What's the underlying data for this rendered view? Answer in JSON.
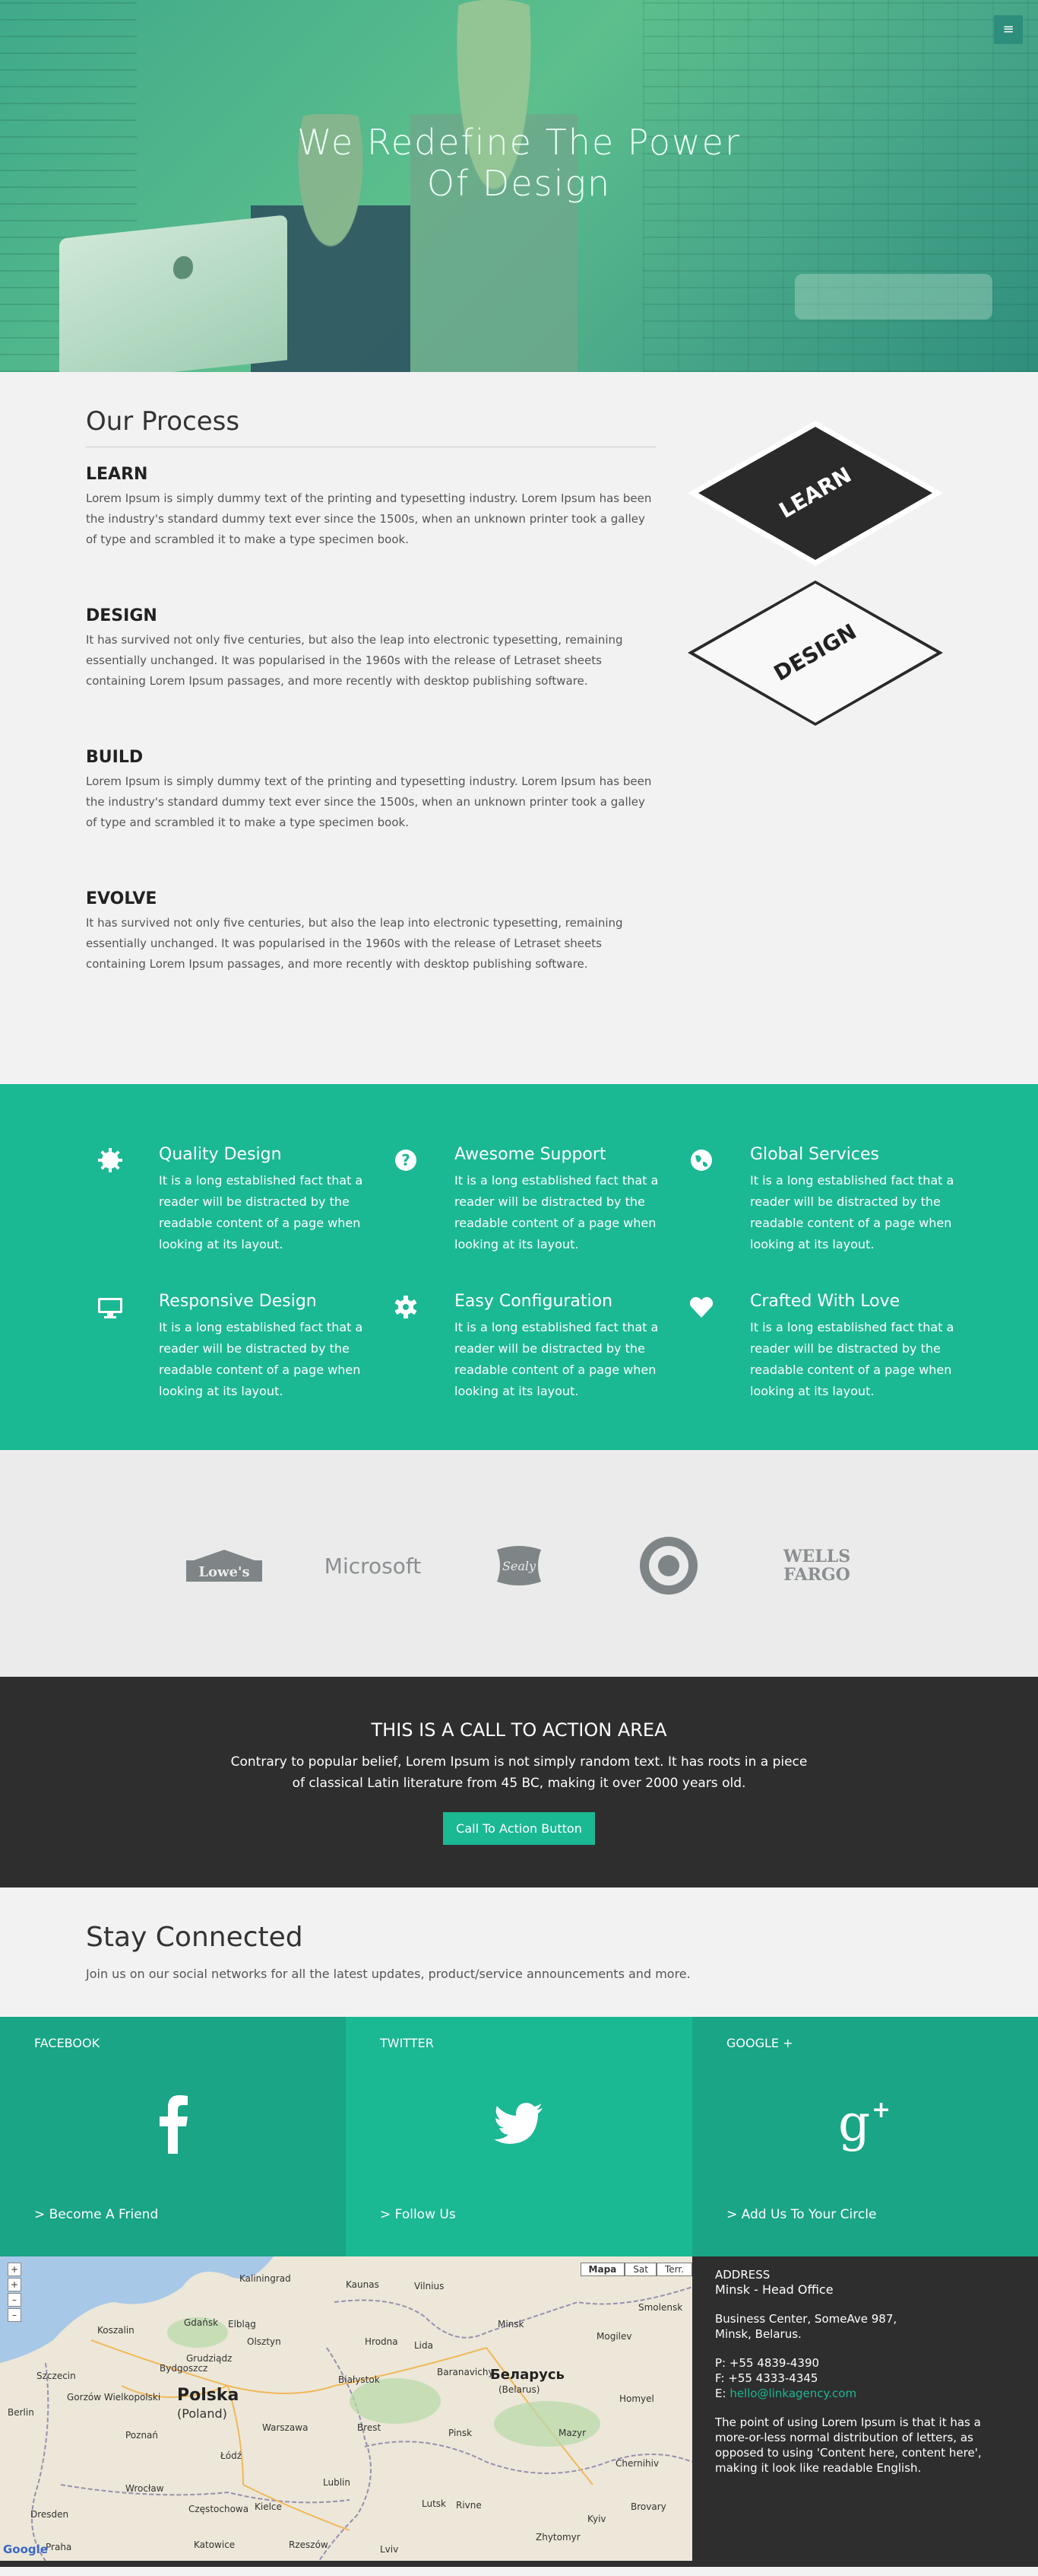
{
  "hero": {
    "title_line1": "We Redefine The Power",
    "title_line2": "Of Design",
    "menu_icon": "hamburger-icon"
  },
  "process": {
    "title": "Our Process",
    "steps": [
      {
        "title": "LEARN",
        "text": "Lorem Ipsum is simply dummy text of the printing and typesetting industry. Lorem Ipsum has been the industry's standard dummy text ever since the 1500s, when an unknown printer took a galley of type and scrambled it to make a type specimen book."
      },
      {
        "title": "DESIGN",
        "text": "It has survived not only five centuries, but also the leap into electronic typesetting, remaining essentially unchanged. It was popularised in the 1960s with the release of Letraset sheets containing Lorem Ipsum passages, and more recently with desktop publishing software."
      },
      {
        "title": "BUILD",
        "text": "Lorem Ipsum is simply dummy text of the printing and typesetting industry. Lorem Ipsum has been the industry's standard dummy text ever since the 1500s, when an unknown printer took a galley of type and scrambled it to make a type specimen book."
      },
      {
        "title": "EVOLVE",
        "text": "It has survived not only five centuries, but also the leap into electronic typesetting, remaining essentially unchanged. It was popularised in the 1960s with the release of Letraset sheets containing Lorem Ipsum passages, and more recently with desktop publishing software."
      }
    ],
    "badges": [
      "LEARN",
      "DESIGN"
    ]
  },
  "features": [
    {
      "icon": "gear-badge-icon",
      "title": "Quality Design",
      "text": "It is a long established fact that a reader will be distracted by the readable content of a page when looking at its layout."
    },
    {
      "icon": "question-circle-icon",
      "title": "Awesome Support",
      "text": "It is a long established fact that a reader will be distracted by the readable content of a page when looking at its layout."
    },
    {
      "icon": "globe-icon",
      "title": "Global Services",
      "text": "It is a long established fact that a reader will be distracted by the readable content of a page when looking at its layout."
    },
    {
      "icon": "desktop-icon",
      "title": "Responsive Design",
      "text": "It is a long established fact that a reader will be distracted by the readable content of a page when looking at its layout."
    },
    {
      "icon": "gear-icon",
      "title": "Easy Configuration",
      "text": "It is a long established fact that a reader will be distracted by the readable content of a page when looking at its layout."
    },
    {
      "icon": "heart-icon",
      "title": "Crafted With Love",
      "text": "It is a long established fact that a reader will be distracted by the readable content of a page when looking at its layout."
    }
  ],
  "logos": [
    "Lowe's",
    "Microsoft",
    "Sealy",
    "Target",
    "WELLS FARGO"
  ],
  "cta": {
    "title": "THIS IS A CALL TO ACTION AREA",
    "text": "Contrary to popular belief, Lorem Ipsum is not simply random text. It has roots in a piece of classical Latin literature from 45 BC, making it over 2000 years old.",
    "button": "Call To Action Button"
  },
  "stay": {
    "title": "Stay Connected",
    "text": "Join us on our social networks for all the latest updates, product/service announcements and more."
  },
  "social": [
    {
      "name": "FACEBOOK",
      "icon": "facebook-icon",
      "link": "> Become A Friend",
      "color": "#19a586"
    },
    {
      "name": "TWITTER",
      "icon": "twitter-icon",
      "link": "> Follow Us",
      "color": "#1bb894"
    },
    {
      "name": "GOOGLE +",
      "icon": "google-plus-icon",
      "link": "> Add Us To Your Circle",
      "color": "#19a586"
    }
  ],
  "map": {
    "types": [
      "Mapa",
      "Sat",
      "Terr."
    ],
    "labels": [
      "Kaliningrad",
      "Kaunas",
      "Vilnius",
      "Gdańsk",
      "Elbląg",
      "Olsztyn",
      "Koszalin",
      "Szczecin",
      "Gorzów Wielkopolski",
      "Bydgoszcz",
      "Grudziądz",
      "Poznań",
      "Berlin",
      "Warszawa",
      "Łódź",
      "Białystok",
      "Hrodna",
      "Minsk",
      "Lida",
      "Baranavichy",
      "Brest",
      "Pinsk",
      "Lublin",
      "Wrocław",
      "Częstochowa",
      "Kielce",
      "Katowice",
      "Rzeszów",
      "Lviv",
      "Rivne",
      "Lutsk",
      "Zhytomyr",
      "Kyiv",
      "Mogilev",
      "Homyel",
      "Mazyr",
      "Chernihiv",
      "Brovary",
      "Smolensk",
      "Dresden",
      "Praha"
    ],
    "country1": "Polska",
    "country1_sub": "(Poland)",
    "country2": "Беларусь",
    "country2_sub": "(Belarus)",
    "google": "Google"
  },
  "address": {
    "heading": "ADDRESS",
    "office": "Minsk - Head Office",
    "line1": "Business Center, SomeAve 987,",
    "line2": "Minsk, Belarus.",
    "phone": "P: +55 4839-4390",
    "fax": "F: +55 4333-4345",
    "email_prefix": "E: ",
    "email": "hello@linkagency.com",
    "blurb": "The point of using Lorem Ipsum is that it has a more-or-less normal distribution of letters, as opposed to using 'Content here, content here', making it look like readable English."
  },
  "colors": {
    "accent": "#1bb894",
    "dark": "#2e2e2e",
    "light": "#f2f2f2"
  }
}
